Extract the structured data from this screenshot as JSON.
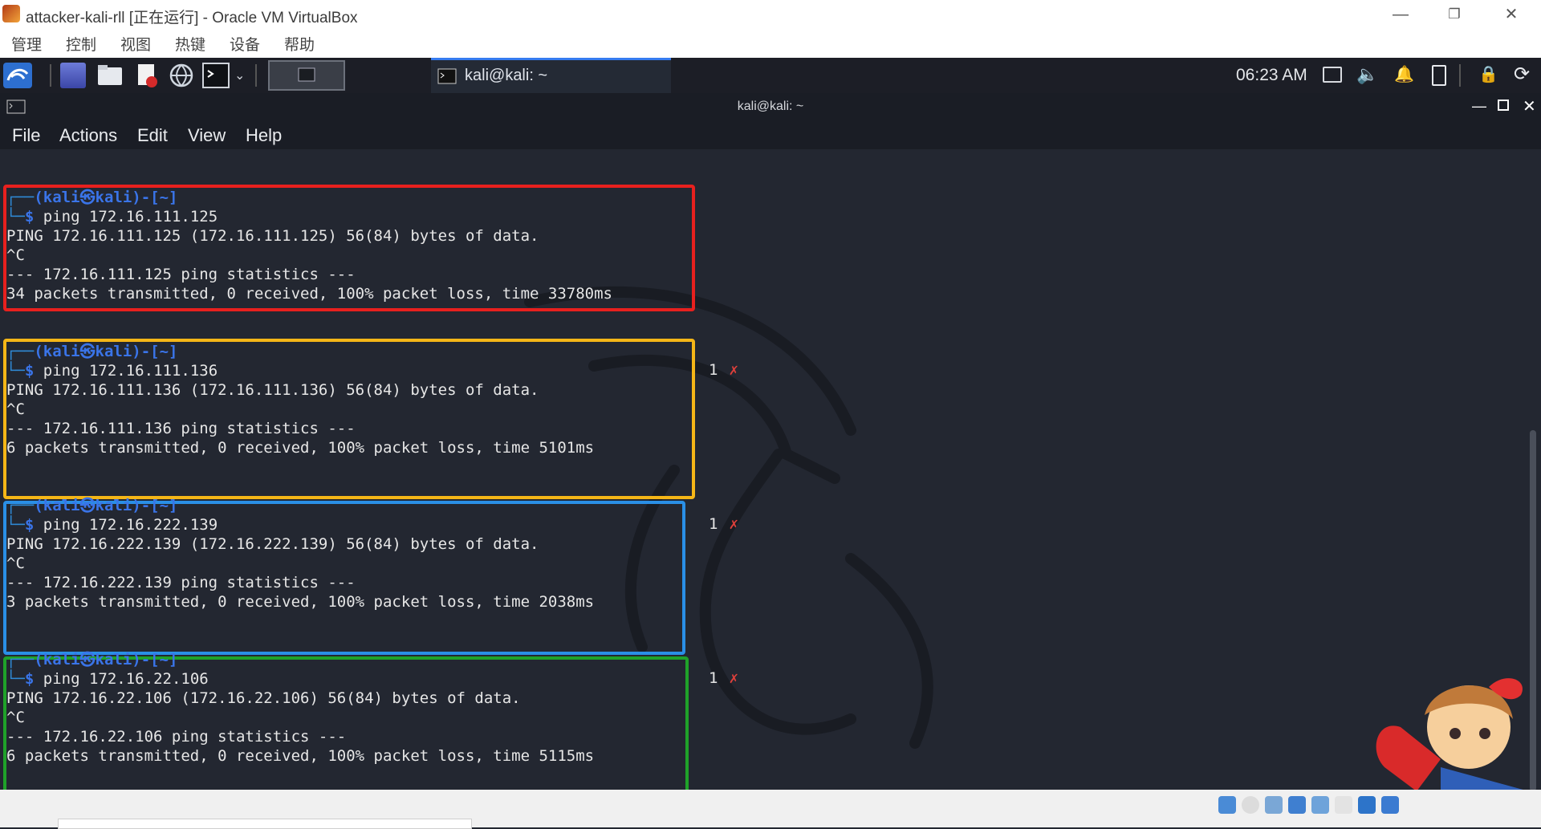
{
  "host_window": {
    "title": "attacker-kali-rll [正在运行] - Oracle VM VirtualBox",
    "menu": [
      "管理",
      "控制",
      "视图",
      "热键",
      "设备",
      "帮助"
    ]
  },
  "panel": {
    "active_task_title": "kali@kali: ~",
    "clock": "06:23 AM"
  },
  "terminal": {
    "window_title": "kali@kali: ~",
    "menu": [
      "File",
      "Actions",
      "Edit",
      "View",
      "Help"
    ],
    "prompt_user": "(kali㉿kali)-[~]",
    "prompt_symbol": "$",
    "blocks": [
      {
        "command": "ping 172.16.111.125",
        "output": [
          "PING 172.16.111.125 (172.16.111.125) 56(84) bytes of data.",
          "^C",
          "--- 172.16.111.125 ping statistics ---",
          "34 packets transmitted, 0 received, 100% packet loss, time 33780ms"
        ],
        "exit_code": ""
      },
      {
        "command": "ping 172.16.111.136",
        "output": [
          "PING 172.16.111.136 (172.16.111.136) 56(84) bytes of data.",
          "^C",
          "--- 172.16.111.136 ping statistics ---",
          "6 packets transmitted, 0 received, 100% packet loss, time 5101ms"
        ],
        "exit_code": "1"
      },
      {
        "command": "ping 172.16.222.139",
        "output": [
          "PING 172.16.222.139 (172.16.222.139) 56(84) bytes of data.",
          "^C",
          "--- 172.16.222.139 ping statistics ---",
          "3 packets transmitted, 0 received, 100% packet loss, time 2038ms"
        ],
        "exit_code": "1"
      },
      {
        "command": "ping 172.16.22.106",
        "output": [
          "PING 172.16.22.106 (172.16.22.106) 56(84) bytes of data.",
          "^C",
          "--- 172.16.22.106 ping statistics ---",
          "6 packets transmitted, 0 received, 100% packet loss, time 5115ms"
        ],
        "exit_code": "1"
      }
    ],
    "error_mark": "✗"
  },
  "colors": {
    "highlight_1": "#e8201e",
    "highlight_2": "#f5b617",
    "highlight_3": "#2a8fe6",
    "highlight_4": "#1fa229",
    "panel_accent": "#367bf0"
  },
  "host_status_icons": [
    "disk-icon",
    "optical-icon",
    "audio-icon",
    "network-icon",
    "usb-icon",
    "shared-folder-icon",
    "display-icon",
    "recording-icon",
    "cpu-icon"
  ]
}
